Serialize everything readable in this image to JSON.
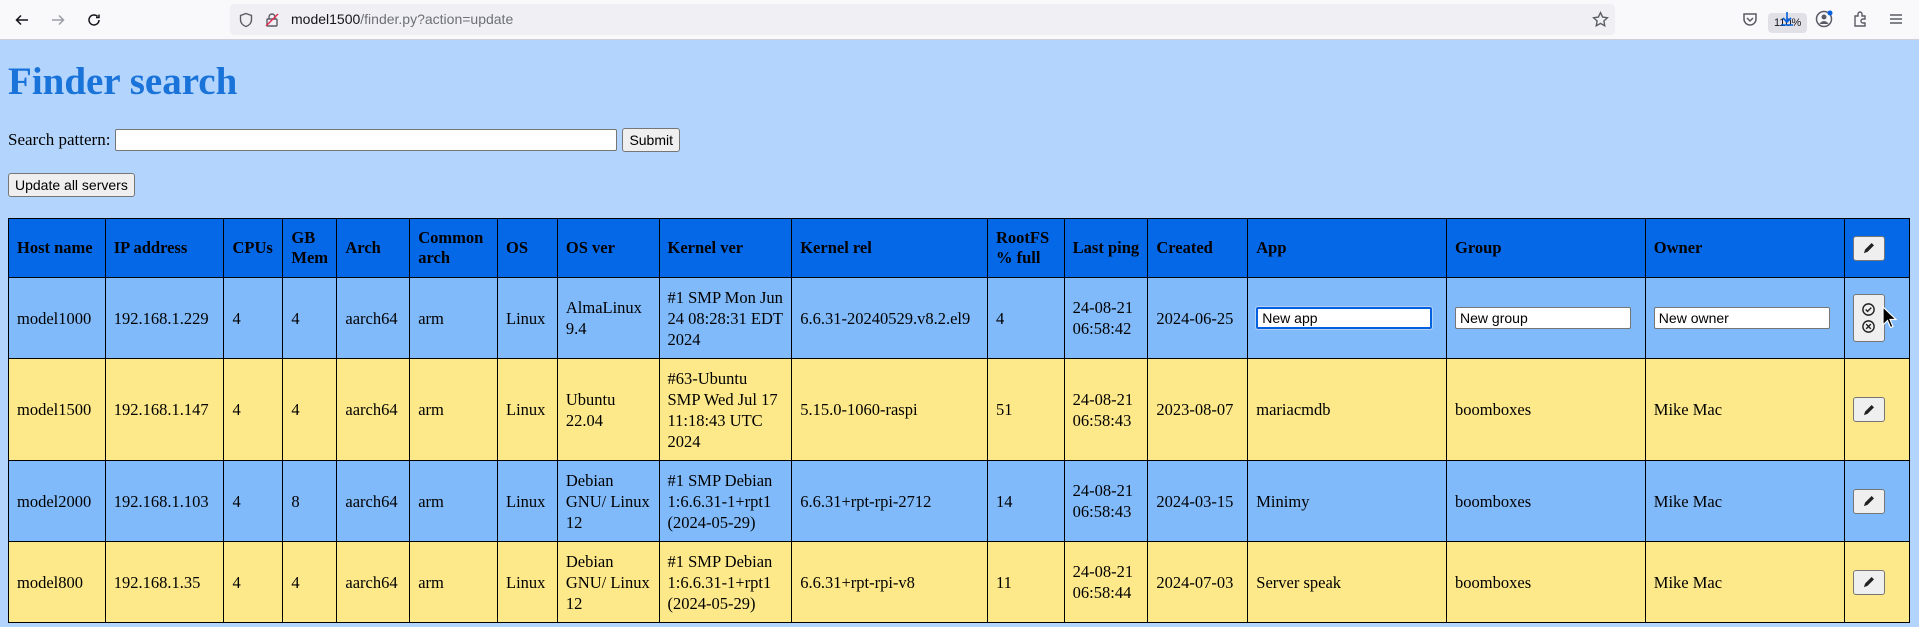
{
  "browser": {
    "url_host": "model1500",
    "url_path": "/finder.py?action=update",
    "zoom": "110%"
  },
  "page": {
    "title": "Finder search",
    "search_label": "Search pattern:",
    "search_value": "",
    "submit_label": "Submit",
    "update_all_label": "Update all servers"
  },
  "table": {
    "headers": {
      "host": "Host name",
      "ip": "IP address",
      "cpus": "CPUs",
      "mem": "GB Mem",
      "arch": "Arch",
      "common_arch": "Common arch",
      "os": "OS",
      "os_ver": "OS ver",
      "kernel_ver": "Kernel ver",
      "kernel_rel": "Kernel rel",
      "rootfs": "RootFS % full",
      "last_ping": "Last ping",
      "created": "Created",
      "app": "App",
      "group": "Group",
      "owner": "Owner"
    },
    "rows": [
      {
        "host": "model1000",
        "ip": "192.168.1.229",
        "cpus": "4",
        "mem": "4",
        "arch": "aarch64",
        "common_arch": "arm",
        "os": "Linux",
        "os_ver": "AlmaLinux 9.4",
        "kernel_ver": "#1 SMP Mon Jun 24 08:28:31 EDT 2024",
        "kernel_rel": "6.6.31-20240529.v8.2.el9",
        "rootfs": "4",
        "last_ping": "24-08-21 06:58:42",
        "created": "2024-06-25",
        "app": "New app",
        "group": "New group",
        "owner": "New owner"
      },
      {
        "host": "model1500",
        "ip": "192.168.1.147",
        "cpus": "4",
        "mem": "4",
        "arch": "aarch64",
        "common_arch": "arm",
        "os": "Linux",
        "os_ver": "Ubuntu 22.04",
        "kernel_ver": "#63-Ubuntu SMP Wed Jul 17 11:18:43 UTC 2024",
        "kernel_rel": "5.15.0-1060-raspi",
        "rootfs": "51",
        "last_ping": "24-08-21 06:58:43",
        "created": "2023-08-07",
        "app": "mariacmdb",
        "group": "boomboxes",
        "owner": "Mike Mac"
      },
      {
        "host": "model2000",
        "ip": "192.168.1.103",
        "cpus": "4",
        "mem": "8",
        "arch": "aarch64",
        "common_arch": "arm",
        "os": "Linux",
        "os_ver": "Debian GNU/ Linux 12",
        "kernel_ver": "#1 SMP Debian 1:6.6.31-1+rpt1 (2024-05-29)",
        "kernel_rel": "6.6.31+rpt-rpi-2712",
        "rootfs": "14",
        "last_ping": "24-08-21 06:58:43",
        "created": "2024-03-15",
        "app": "Minimy",
        "group": "boomboxes",
        "owner": "Mike Mac"
      },
      {
        "host": "model800",
        "ip": "192.168.1.35",
        "cpus": "4",
        "mem": "4",
        "arch": "aarch64",
        "common_arch": "arm",
        "os": "Linux",
        "os_ver": "Debian GNU/ Linux 12",
        "kernel_ver": "#1 SMP Debian 1:6.6.31-1+rpt1 (2024-05-29)",
        "kernel_rel": "6.6.31+rpt-rpi-v8",
        "rootfs": "11",
        "last_ping": "24-08-21 06:58:44",
        "created": "2024-07-03",
        "app": "Server speak",
        "group": "boomboxes",
        "owner": "Mike Mac"
      }
    ]
  },
  "colors": {
    "title": "#1a73d9",
    "header": "#0568e6",
    "row_blue": "#81bafa",
    "row_yellow": "#fde98a",
    "background": "#b3d5fd"
  }
}
